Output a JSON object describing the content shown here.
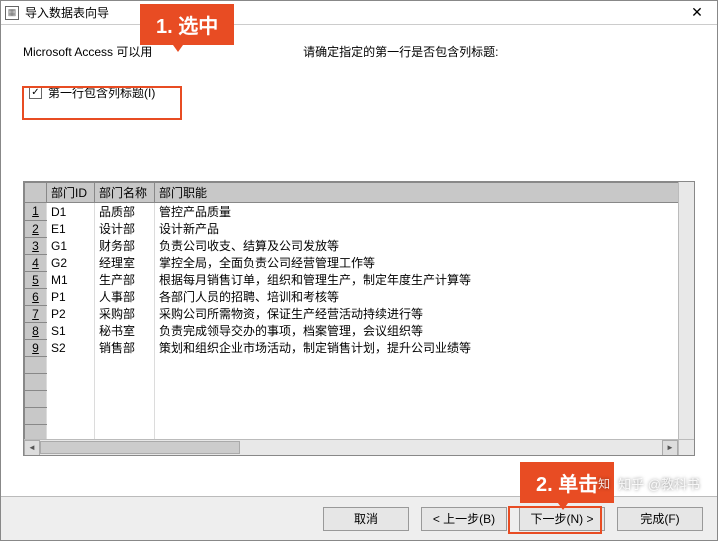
{
  "titlebar": {
    "title": "导入数据表向导",
    "close": "✕"
  },
  "desc_prefix": "Microsoft Access 可以用",
  "desc_suffix": "请确定指定的第一行是否包含列标题:",
  "checkbox": {
    "label": "第一行包含列标题(I)",
    "checked": "✓"
  },
  "columns": [
    "部门ID",
    "部门名称",
    "部门职能"
  ],
  "rows": [
    {
      "n": "1",
      "id": "D1",
      "name": "品质部",
      "func": "管控产品质量"
    },
    {
      "n": "2",
      "id": "E1",
      "name": "设计部",
      "func": "设计新产品"
    },
    {
      "n": "3",
      "id": "G1",
      "name": "财务部",
      "func": "负责公司收支、结算及公司发放等"
    },
    {
      "n": "4",
      "id": "G2",
      "name": "经理室",
      "func": "掌控全局，全面负责公司经营管理工作等"
    },
    {
      "n": "5",
      "id": "M1",
      "name": "生产部",
      "func": "根据每月销售订单，组织和管理生产，制定年度生产计算等"
    },
    {
      "n": "6",
      "id": "P1",
      "name": "人事部",
      "func": "各部门人员的招聘、培训和考核等"
    },
    {
      "n": "7",
      "id": "P2",
      "name": "采购部",
      "func": "采购公司所需物资，保证生产经营活动持续进行等"
    },
    {
      "n": "8",
      "id": "S1",
      "name": "秘书室",
      "func": "负责完成领导交办的事项，档案管理，会议组织等"
    },
    {
      "n": "9",
      "id": "S2",
      "name": "销售部",
      "func": "策划和组织企业市场活动，制定销售计划，提升公司业绩等"
    }
  ],
  "buttons": {
    "cancel": "取消",
    "back": "< 上一步(B)",
    "next": "下一步(N) >",
    "finish": "完成(F)"
  },
  "callouts": {
    "c1": "1. 选中",
    "c2": "2. 单击"
  },
  "watermark": {
    "icon": "知",
    "text": "知乎 @教科书"
  }
}
